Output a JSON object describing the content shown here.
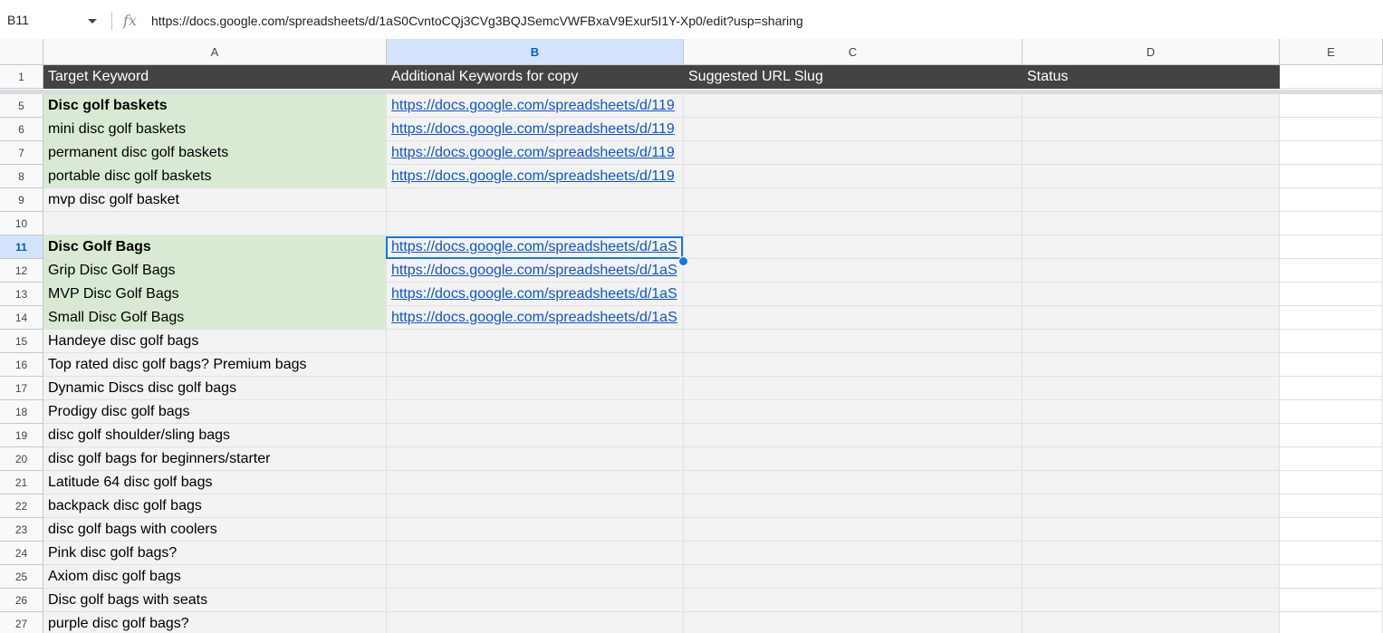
{
  "formula_bar": {
    "name_box": "B11",
    "fx_label": "fx",
    "formula": "https://docs.google.com/spreadsheets/d/1aS0CvntoCQj3CVg3BQJSemcVWFBxaV9Exur5I1Y-Xp0/edit?usp=sharing"
  },
  "columns": [
    "A",
    "B",
    "C",
    "D",
    "E"
  ],
  "selected_column": "B",
  "header_row": {
    "number": "1",
    "cells": [
      "Target Keyword",
      "Additional Keywords for copy",
      "Suggested URL Slug",
      "Status"
    ]
  },
  "rows": [
    {
      "number": "5",
      "a": "Disc golf baskets",
      "b": "https://docs.google.com/spreadsheets/d/119"
    },
    {
      "number": "6",
      "a": "mini disc golf baskets",
      "b": "https://docs.google.com/spreadsheets/d/119"
    },
    {
      "number": "7",
      "a": "permanent disc golf baskets",
      "b": "https://docs.google.com/spreadsheets/d/119"
    },
    {
      "number": "8",
      "a": "portable disc golf baskets",
      "b": "https://docs.google.com/spreadsheets/d/119"
    },
    {
      "number": "9",
      "a": "mvp disc golf basket",
      "b": ""
    },
    {
      "number": "10",
      "a": "",
      "b": ""
    },
    {
      "number": "11",
      "a": "Disc Golf Bags",
      "b": "https://docs.google.com/spreadsheets/d/1aS"
    },
    {
      "number": "12",
      "a": "Grip Disc Golf Bags",
      "b": "https://docs.google.com/spreadsheets/d/1aS"
    },
    {
      "number": "13",
      "a": "MVP Disc Golf Bags",
      "b": "https://docs.google.com/spreadsheets/d/1aS"
    },
    {
      "number": "14",
      "a": "Small Disc Golf Bags",
      "b": "https://docs.google.com/spreadsheets/d/1aS"
    },
    {
      "number": "15",
      "a": "Handeye disc golf bags",
      "b": ""
    },
    {
      "number": "16",
      "a": "Top rated disc golf bags? Premium bags",
      "b": ""
    },
    {
      "number": "17",
      "a": "Dynamic Discs disc golf bags",
      "b": ""
    },
    {
      "number": "18",
      "a": "Prodigy disc golf bags",
      "b": ""
    },
    {
      "number": "19",
      "a": "disc golf shoulder/sling bags",
      "b": ""
    },
    {
      "number": "20",
      "a": "disc golf bags for beginners/starter",
      "b": ""
    },
    {
      "number": "21",
      "a": "Latitude 64 disc golf bags",
      "b": ""
    },
    {
      "number": "22",
      "a": "backpack disc golf bags",
      "b": ""
    },
    {
      "number": "23",
      "a": "disc golf bags with coolers",
      "b": ""
    },
    {
      "number": "24",
      "a": "Pink disc golf bags?",
      "b": ""
    },
    {
      "number": "25",
      "a": "Axiom disc golf bags",
      "b": ""
    },
    {
      "number": "26",
      "a": "Disc golf bags with seats",
      "b": ""
    },
    {
      "number": "27",
      "a": "purple disc golf bags?",
      "b": ""
    }
  ],
  "colors": {
    "header_fill": "#434343",
    "green_fill": "#d9ead3",
    "link": "#1155cc",
    "selection": "#1a73e8"
  }
}
